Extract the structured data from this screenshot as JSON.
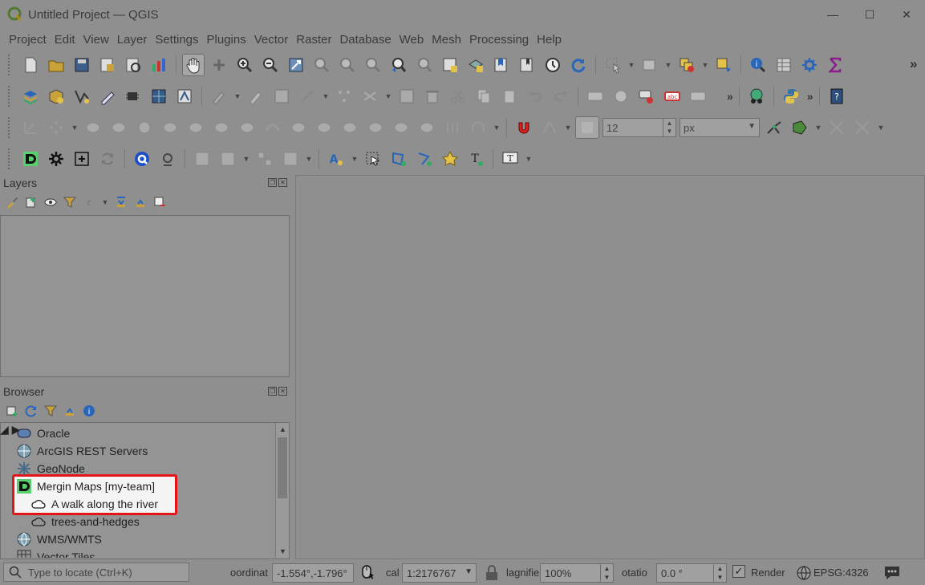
{
  "window": {
    "title": "Untitled Project — QGIS",
    "minimize": "—",
    "maximize": "☐",
    "close": "✕"
  },
  "menu": [
    "Project",
    "Edit",
    "View",
    "Layer",
    "Settings",
    "Plugins",
    "Vector",
    "Raster",
    "Database",
    "Web",
    "Mesh",
    "Processing",
    "Help"
  ],
  "toolbar3": {
    "snap_tolerance": "12",
    "snap_unit": "px"
  },
  "layers_panel": {
    "title": "Layers"
  },
  "browser_panel": {
    "title": "Browser",
    "items": [
      {
        "label": "Oracle",
        "icon": "oracle-icon"
      },
      {
        "label": "ArcGIS REST Servers",
        "icon": "arcgis-icon"
      },
      {
        "label": "GeoNode",
        "icon": "geonode-icon"
      },
      {
        "label": "Mergin Maps [my-team]",
        "icon": "mergin-maps-icon"
      },
      {
        "label": "A walk along the river",
        "icon": "cloud-icon"
      },
      {
        "label": "trees-and-hedges",
        "icon": "cloud-icon"
      },
      {
        "label": "WMS/WMTS",
        "icon": "globe-icon"
      },
      {
        "label": "Vector Tiles",
        "icon": "grid-icon"
      }
    ]
  },
  "statusbar": {
    "locate_placeholder": "Type to locate (Ctrl+K)",
    "coordinate_label": "oordinat",
    "coordinate_value": "-1.554°,-1.796°",
    "scale_label": "cal",
    "scale_value": "1:2176767",
    "magnifier_label": "lagnifie",
    "magnifier_value": "100%",
    "rotation_label": "otatio",
    "rotation_value": "0.0 °",
    "render_label": "Render",
    "render_checked": "✓",
    "crs": "EPSG:4326"
  },
  "colors": {
    "highlight_border": "#e3151a",
    "mergin_green": "#58d06b"
  }
}
